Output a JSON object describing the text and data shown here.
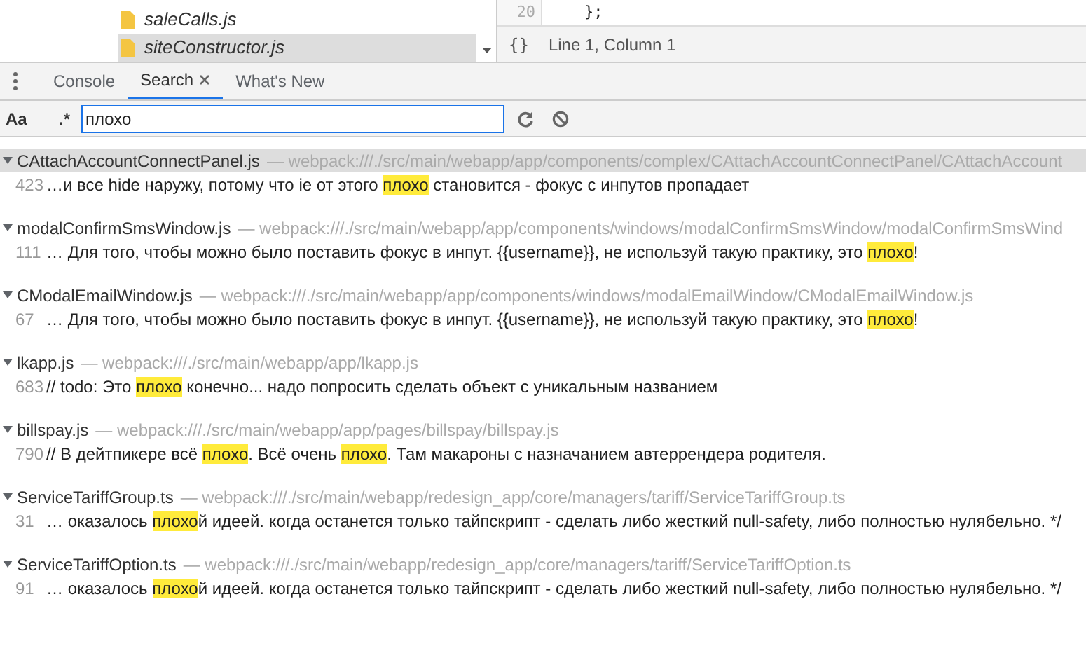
{
  "file_tree": {
    "items": [
      {
        "name": "saleCalls.js",
        "selected": false
      },
      {
        "name": "siteConstructor.js",
        "selected": true
      }
    ]
  },
  "editor": {
    "line_number": "20",
    "code": "};",
    "status": "Line 1, Column 1",
    "format_label": "{}"
  },
  "drawer_tabs": [
    {
      "label": "Console",
      "selected": false,
      "closable": false
    },
    {
      "label": "Search",
      "selected": true,
      "closable": true
    },
    {
      "label": "What's New",
      "selected": false,
      "closable": false
    }
  ],
  "search": {
    "match_case_label": "Aa",
    "regex_label": ".*",
    "value": "плохо"
  },
  "results": [
    {
      "file": "CAttachAccountConnectPanel.js",
      "path": "— webpack:///./src/main/webapp/app/components/complex/CAttachAccountConnectPanel/CAttachAccount",
      "expanded": true,
      "selected": true,
      "matches": [
        {
          "line": "423",
          "segments": [
            {
              "text": "…и все hide наружу, потому что ie от этого ",
              "match": false
            },
            {
              "text": "плохо",
              "match": true
            },
            {
              "text": " становится - фокус с инпутов пропадает",
              "match": false
            }
          ]
        }
      ]
    },
    {
      "file": "modalConfirmSmsWindow.js",
      "path": "— webpack:///./src/main/webapp/app/components/windows/modalConfirmSmsWindow/modalConfirmSmsWind",
      "expanded": true,
      "selected": false,
      "matches": [
        {
          "line": "111",
          "segments": [
            {
              "text": "… Для того, чтобы можно было поставить фокус в инпут. {{username}}, не используй такую практику, это ",
              "match": false
            },
            {
              "text": "плохо",
              "match": true
            },
            {
              "text": "!",
              "match": false
            }
          ]
        }
      ]
    },
    {
      "file": "CModalEmailWindow.js",
      "path": "— webpack:///./src/main/webapp/app/components/windows/modalEmailWindow/CModalEmailWindow.js",
      "expanded": true,
      "selected": false,
      "matches": [
        {
          "line": "67",
          "segments": [
            {
              "text": "… Для того, чтобы можно было поставить фокус в инпут. {{username}}, не используй такую практику, это ",
              "match": false
            },
            {
              "text": "плохо",
              "match": true
            },
            {
              "text": "!",
              "match": false
            }
          ]
        }
      ]
    },
    {
      "file": "lkapp.js",
      "path": "— webpack:///./src/main/webapp/app/lkapp.js",
      "expanded": true,
      "selected": false,
      "matches": [
        {
          "line": "683",
          "segments": [
            {
              "text": "// todo: Это ",
              "match": false
            },
            {
              "text": "плохо",
              "match": true
            },
            {
              "text": " конечно... надо попросить сделать объект с уникальным названием",
              "match": false
            }
          ]
        }
      ]
    },
    {
      "file": "billspay.js",
      "path": "— webpack:///./src/main/webapp/app/pages/billspay/billspay.js",
      "expanded": true,
      "selected": false,
      "matches": [
        {
          "line": "790",
          "segments": [
            {
              "text": "// В дейтпикере всё ",
              "match": false
            },
            {
              "text": "плохо",
              "match": true
            },
            {
              "text": ". Всё очень ",
              "match": false
            },
            {
              "text": "плохо",
              "match": true
            },
            {
              "text": ". Там макароны с назначанием автеррендера родителя.",
              "match": false
            }
          ]
        }
      ]
    },
    {
      "file": "ServiceTariffGroup.ts",
      "path": "— webpack:///./src/main/webapp/redesign_app/core/managers/tariff/ServiceTariffGroup.ts",
      "expanded": true,
      "selected": false,
      "matches": [
        {
          "line": "31",
          "segments": [
            {
              "text": "… оказалось ",
              "match": false
            },
            {
              "text": "плохо",
              "match": true
            },
            {
              "text": "й идеей. когда останется только тайпскрипт - сделать либо жесткий null-safety, либо полностью нулябельно. */",
              "match": false
            }
          ]
        }
      ]
    },
    {
      "file": "ServiceTariffOption.ts",
      "path": "— webpack:///./src/main/webapp/redesign_app/core/managers/tariff/ServiceTariffOption.ts",
      "expanded": true,
      "selected": false,
      "matches": [
        {
          "line": "91",
          "segments": [
            {
              "text": "… оказалось ",
              "match": false
            },
            {
              "text": "плохо",
              "match": true
            },
            {
              "text": "й идеей. когда останется только тайпскрипт - сделать либо жесткий null-safety, либо полностью нулябельно. */",
              "match": false
            }
          ]
        }
      ]
    }
  ]
}
